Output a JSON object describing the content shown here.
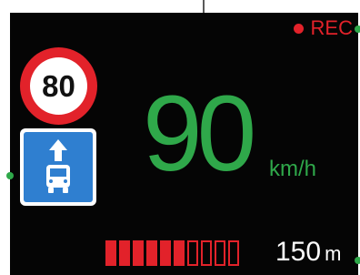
{
  "recording": {
    "label": "REC",
    "color": "#e2222a"
  },
  "speed_limit": {
    "value": "80",
    "border_color": "#e2222a"
  },
  "lane_sign": {
    "type": "bus-lane",
    "icon": "bus-icon",
    "color": "#2f7fd0"
  },
  "speed": {
    "value": "90",
    "unit": "km/h",
    "color": "#2fa84a"
  },
  "distance": {
    "value": "150",
    "unit": "m",
    "segments_total": 10,
    "segments_filled": 6,
    "color": "#e2222a"
  }
}
